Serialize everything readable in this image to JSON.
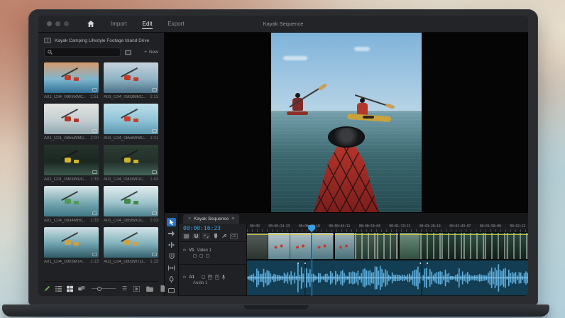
{
  "window": {
    "title": "Kayak Sequence",
    "nav": [
      {
        "label": "Import",
        "active": false
      },
      {
        "label": "Edit",
        "active": true
      },
      {
        "label": "Export",
        "active": false
      }
    ]
  },
  "glyphs": {
    "close": "×",
    "panel_menu": "≡",
    "plus": "+",
    "sort": "☰"
  },
  "project_panel": {
    "bin_title": "Kayak Camping Lifestyle Footage Island Drive",
    "search": {
      "placeholder": "",
      "value": ""
    },
    "new_button_label": "New",
    "toolbar_icons": [
      "edit-pencil",
      "list-view",
      "grid-view",
      "freeform-view",
      "zoom-slider",
      "sort-menu",
      "automate-to-sequence",
      "new-bin",
      "new-item",
      "delete"
    ],
    "clips": [
      {
        "name": "A01_C04_0903RMC..",
        "duration": "1:51",
        "art": {
          "t1": "#d79a6b",
          "t2": "#7fb6cf",
          "t3": "#2f6f94",
          "ta": "#c23b28"
        }
      },
      {
        "name": "A01_C04_0903MRC..",
        "duration": "2:13",
        "art": {
          "t1": "#c6d3dd",
          "t2": "#8fb3c4",
          "t3": "#4a7086",
          "ta": "#c23b28"
        }
      },
      {
        "name": "A01_C01_0855WMC..",
        "duration": "2:00",
        "art": {
          "t1": "#e3e4e0",
          "t2": "#c2cdd1",
          "t3": "#8fa7ae",
          "ta": "#b23527"
        }
      },
      {
        "name": "A01_C04_0858WMC..",
        "duration": "1:01",
        "art": {
          "t1": "#bfe0ea",
          "t2": "#8fc3d6",
          "t3": "#5a98b0",
          "ta": "#c8402e"
        }
      },
      {
        "name": "A01_C01_0903WDC..",
        "duration": "1:33",
        "art": {
          "t1": "#25332b",
          "t2": "#1b2722",
          "t3": "#3c5a4e",
          "ta": "#d3b62f"
        }
      },
      {
        "name": "A01_C04_0903WUC..",
        "duration": "1:43",
        "art": {
          "t1": "#2e3d33",
          "t2": "#22302a",
          "t3": "#44645a",
          "ta": "#cdb32e"
        }
      },
      {
        "name": "A01_C04_0834MRC..",
        "duration": "1:33",
        "art": {
          "t1": "#d9e6e8",
          "t2": "#77a7b2",
          "t3": "#3f7886",
          "ta": "#4f9a54"
        }
      },
      {
        "name": "A01_C04_0858WDC..",
        "duration": "2:03",
        "art": {
          "t1": "#e2ecee",
          "t2": "#9fc4cc",
          "t3": "#4c828e",
          "ta": "#3f8a46"
        }
      },
      {
        "name": "A01_C04_0903MTA..",
        "duration": "1:13",
        "art": {
          "t1": "#cfe0e4",
          "t2": "#6fa2ae",
          "t3": "#2f5a66",
          "ta": "#caa24a"
        }
      },
      {
        "name": "A01_C04_0803WTD..",
        "duration": "1:13",
        "art": {
          "t1": "#d5e4e8",
          "t2": "#7fb0ba",
          "t3": "#35626e",
          "ta": "#caa24a"
        }
      }
    ]
  },
  "preview": {
    "colors": {
      "sky1": "#7fb3da",
      "sky2": "#b7d4e6",
      "horizon": "#93a4a2",
      "water1": "#74a0ac",
      "water2": "#3a666d",
      "water3": "#24494f",
      "bow1": "#c23a30",
      "bow2": "#7c1d1b",
      "hatch": "#141517",
      "kayak_yellow": "#c9a23c",
      "jacket_red": "#b4382a",
      "pfd_dark": "#7e2a2a",
      "paddle": "#c8a05e"
    }
  },
  "timeline": {
    "tab_label": "Kayak Sequence",
    "timecode": "00:00:16:23",
    "tools": [
      "selection-tool",
      "track-select-forward-tool",
      "ripple-edit-tool",
      "razor-tool",
      "slip-tool",
      "pen-tool",
      "type-tool"
    ],
    "toggles": [
      "nest-toggle",
      "snap-toggle",
      "linked-selection-toggle",
      "marker-button",
      "timeline-settings"
    ],
    "cc_label": "CC",
    "ruler_labels": [
      "00:00",
      "00:00:14:23",
      "00:00:29:18",
      "00:00:44:11",
      "00:00:59:04",
      "00:01:13:21",
      "00:01:28:14",
      "00:01:43:07",
      "00:01:58:00",
      "00:02:12"
    ],
    "playhead_pct": 23,
    "video_track": {
      "fx": "fx",
      "id": "V1",
      "name": "Video 1"
    },
    "audio_track": {
      "fx": "fx",
      "id": "A1",
      "name": "Audio 1",
      "mute": "M",
      "solo": "S"
    },
    "video_clip_cuts_pct": [
      30.8,
      53.9
    ],
    "audio_clip_cuts_pct": [
      20.5,
      62
    ],
    "frames": [
      {
        "a": "#55605b",
        "b": "#2b332f",
        "figs": false,
        "streak": false
      },
      {
        "a": "#b9c6cb",
        "b": "#5f8792",
        "figs": true,
        "streak": false
      },
      {
        "a": "#b3c1c6",
        "b": "#58828e",
        "figs": true,
        "streak": false
      },
      {
        "a": "#a8bac0",
        "b": "#4f7884",
        "figs": true,
        "streak": false
      },
      {
        "a": "#9fb3b8",
        "b": "#47707c",
        "figs": true,
        "streak": false
      },
      {
        "a": "#46604f",
        "b": "#243a30",
        "figs": false,
        "streak": true
      },
      {
        "a": "#3c5747",
        "b": "#1f342b",
        "figs": false,
        "streak": true
      },
      {
        "a": "#6f8d7d",
        "b": "#32503f",
        "figs": false,
        "streak": false
      },
      {
        "a": "#2c4a3b",
        "b": "#16281f",
        "figs": false,
        "streak": true
      },
      {
        "a": "#26453a",
        "b": "#122018",
        "figs": false,
        "streak": true
      },
      {
        "a": "#2f5242",
        "b": "#16291f",
        "figs": false,
        "streak": true
      },
      {
        "a": "#223f33",
        "b": "#101d16",
        "figs": false,
        "streak": true
      },
      {
        "a": "#2a4a3c",
        "b": "#14241c",
        "figs": false,
        "streak": true
      }
    ],
    "colors": {
      "audio_bg": "#123d52",
      "waveform": "#5fb0e0",
      "wave_center": "#8fd0f4",
      "opacity_line": "#d6cf3a",
      "playhead": "#35a0e8",
      "timecode": "#36a3e8"
    }
  }
}
